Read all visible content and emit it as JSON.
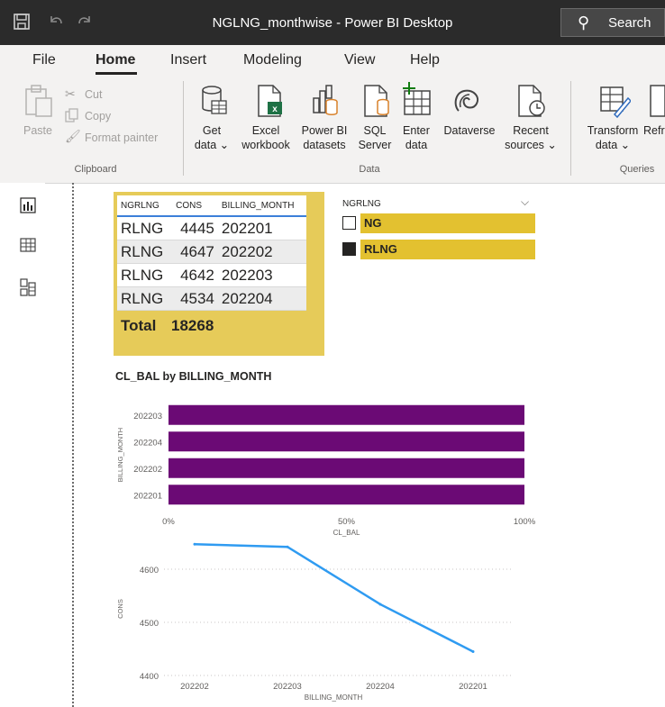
{
  "window": {
    "title": "NGLNG_monthwise - Power BI Desktop",
    "search_label": "Search"
  },
  "menu": {
    "items": [
      "File",
      "Home",
      "Insert",
      "Modeling",
      "View",
      "Help"
    ],
    "active": "Home"
  },
  "ribbon": {
    "clipboard": {
      "paste": "Paste",
      "cut": "Cut",
      "copy": "Copy",
      "format_painter": "Format painter",
      "group": "Clipboard"
    },
    "data": {
      "get_data": [
        "Get",
        "data ⌄"
      ],
      "excel": [
        "Excel",
        "workbook"
      ],
      "powerbi": [
        "Power BI",
        "datasets"
      ],
      "sql": [
        "SQL",
        "Server"
      ],
      "enter": [
        "Enter",
        "data"
      ],
      "dataverse": [
        "Dataverse"
      ],
      "recent": [
        "Recent",
        "sources ⌄"
      ],
      "group": "Data"
    },
    "queries": {
      "transform": [
        "Transform",
        "data ⌄"
      ],
      "refresh": "Refr",
      "group": "Queries"
    }
  },
  "table_visual": {
    "headers": [
      "NGRLNG",
      "CONS",
      "BILLING_MONTH"
    ],
    "rows": [
      [
        "RLNG",
        "4445",
        "202201"
      ],
      [
        "RLNG",
        "4647",
        "202202"
      ],
      [
        "RLNG",
        "4642",
        "202203"
      ],
      [
        "RLNG",
        "4534",
        "202204"
      ]
    ],
    "total_label": "Total",
    "total_value": "18268"
  },
  "slicer": {
    "title": "NGRLNG",
    "items": [
      {
        "label": "NG",
        "checked": false
      },
      {
        "label": "RLNG",
        "checked": true
      }
    ],
    "highlight_color": "#e3c130"
  },
  "chart_data": [
    {
      "type": "bar",
      "orientation": "horizontal",
      "title": "CL_BAL by BILLING_MONTH",
      "categories": [
        "202203",
        "202204",
        "202202",
        "202201"
      ],
      "values": [
        100,
        100,
        100,
        100
      ],
      "xlabel": "CL_BAL",
      "ylabel": "BILLING_MONTH",
      "xlim": [
        0,
        100
      ],
      "xticks": [
        "0%",
        "50%",
        "100%"
      ],
      "color": "#6b0a75"
    },
    {
      "type": "line",
      "title": "",
      "x": [
        "202202",
        "202203",
        "202204",
        "202201"
      ],
      "values": [
        4647,
        4642,
        4534,
        4445
      ],
      "xlabel": "BILLING_MONTH",
      "ylabel": "CONS",
      "ylim": [
        4400,
        4650
      ],
      "yticks": [
        4400,
        4500,
        4600
      ],
      "color": "#2f9bf1"
    }
  ]
}
